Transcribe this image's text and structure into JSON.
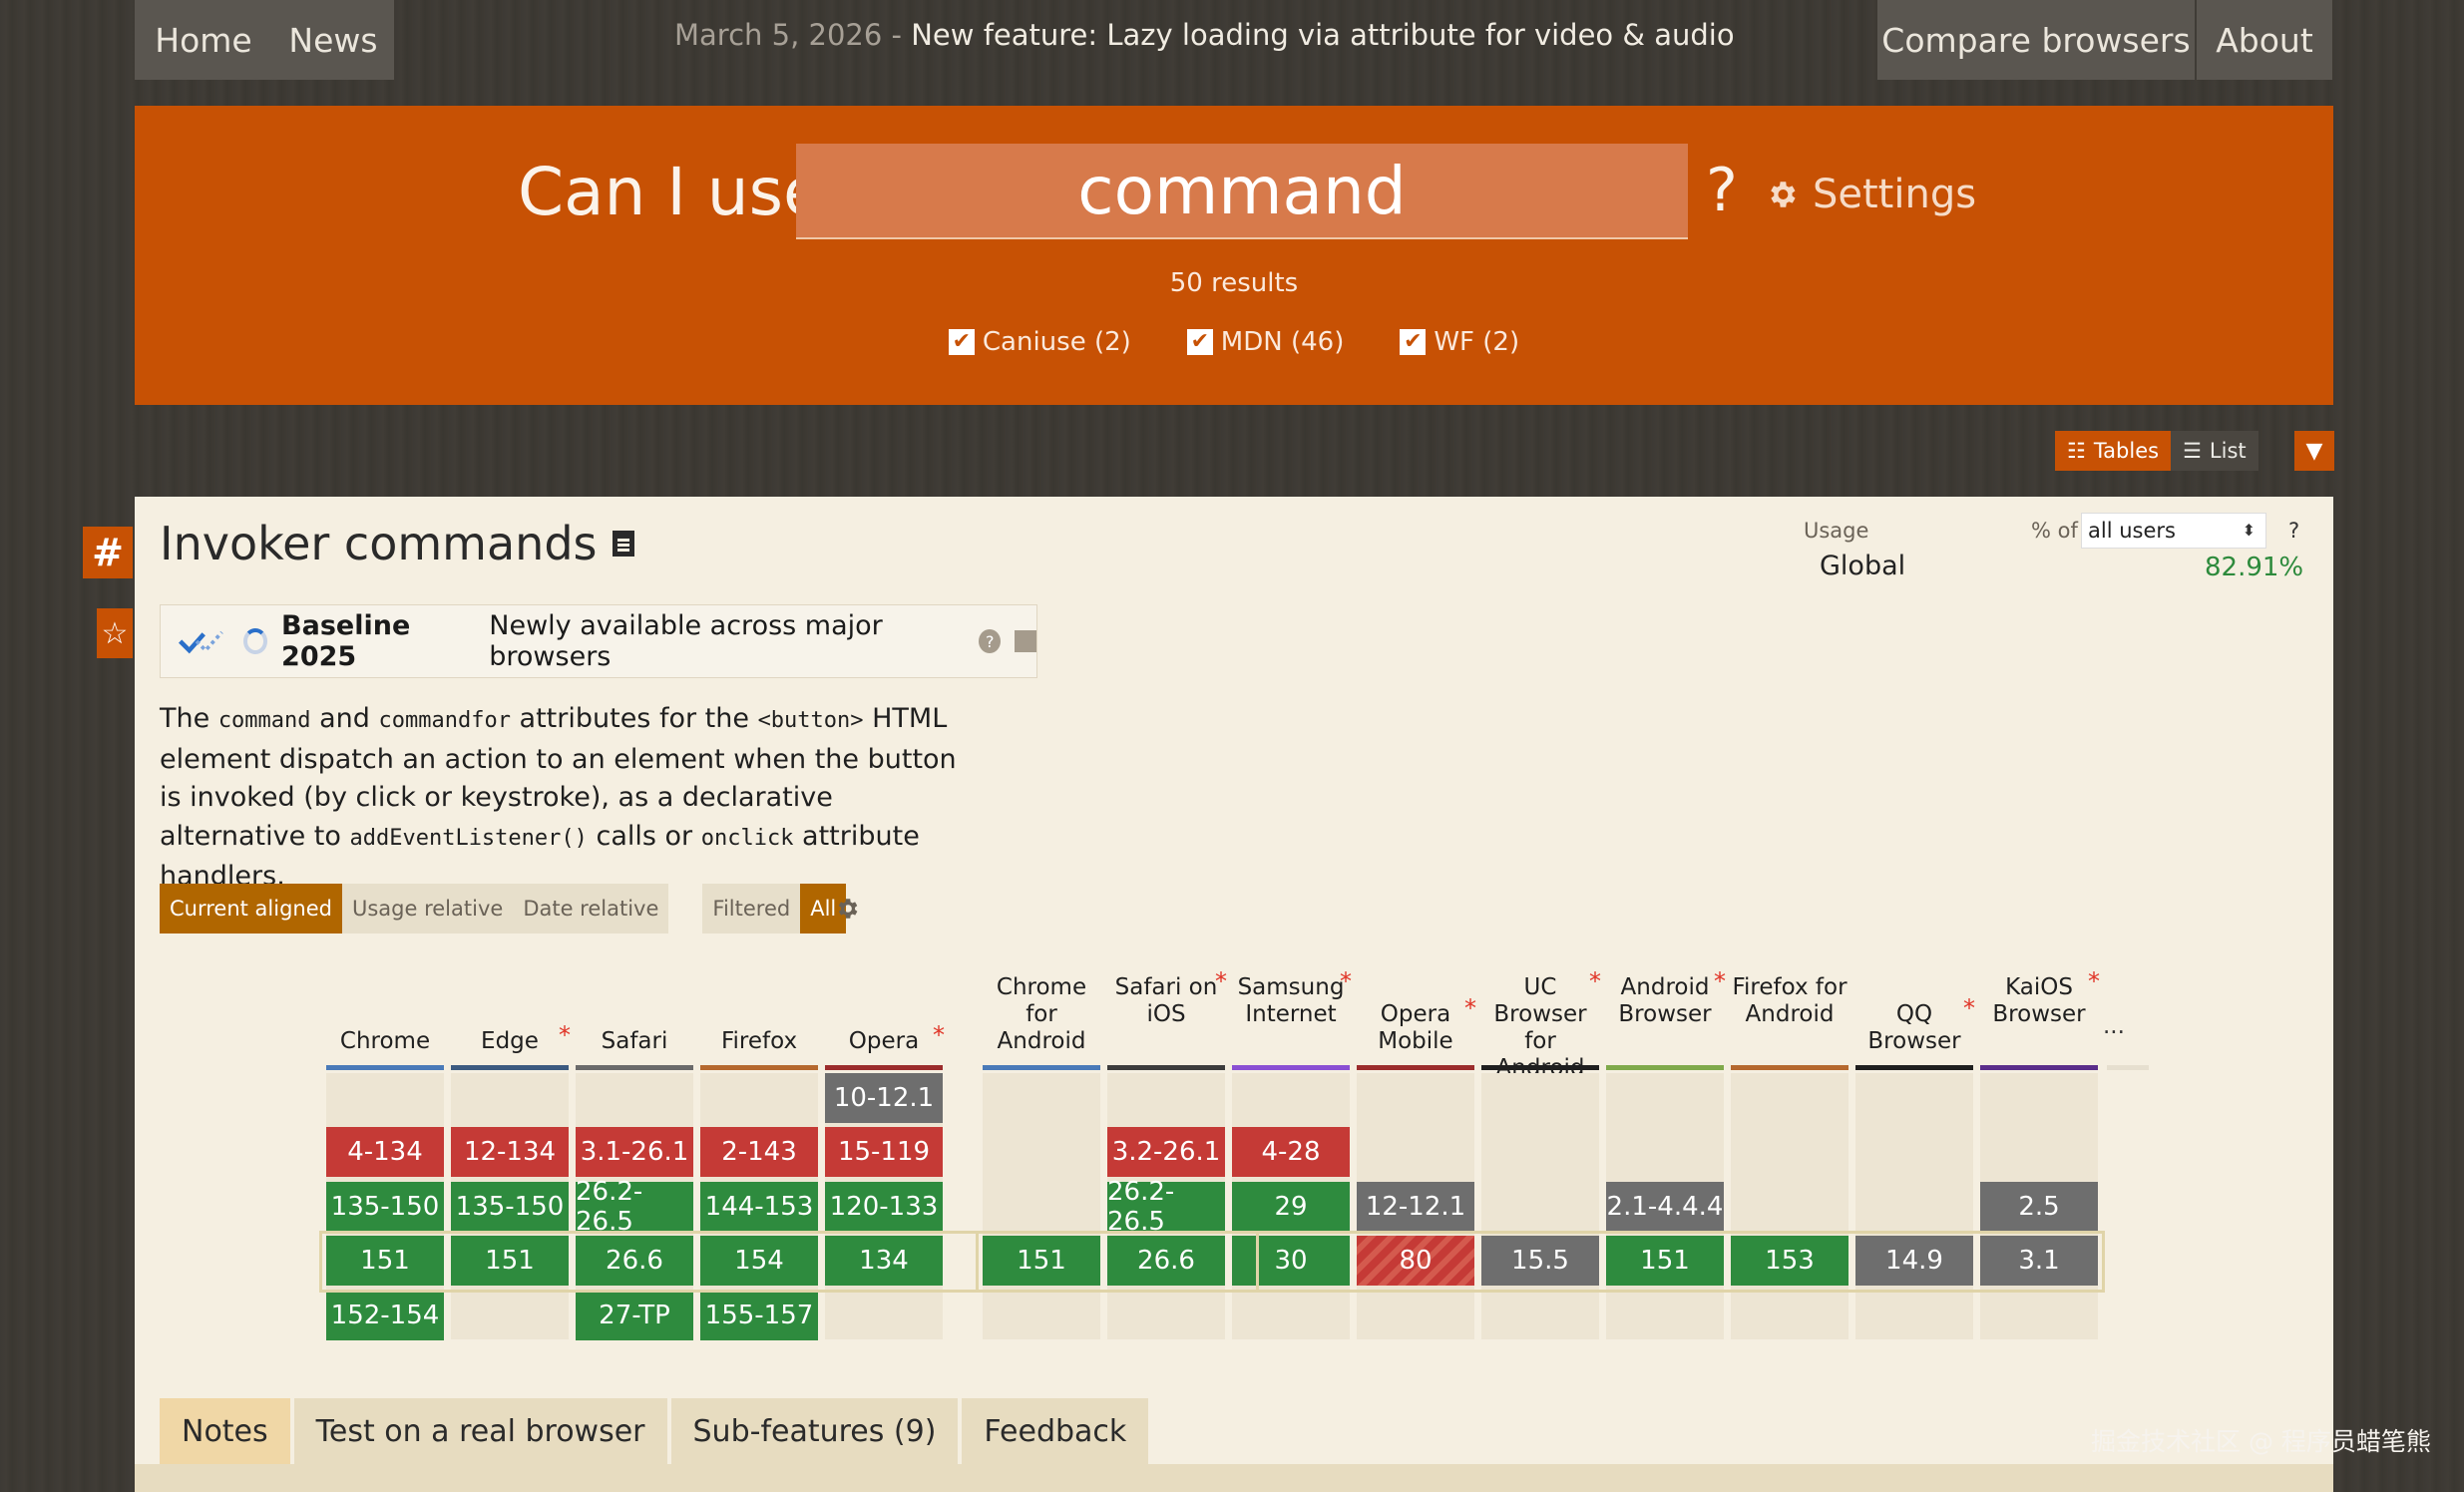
{
  "nav": {
    "home": "Home",
    "news": "News",
    "date": "March 5, 2026",
    "sep": " - ",
    "announcement": "New feature: Lazy loading via attribute for video & audio",
    "compare": "Compare browsers",
    "about": "About"
  },
  "hero": {
    "label": "Can I use",
    "query": "command",
    "qmark": "?",
    "settings": "Settings",
    "results": "50 results",
    "filters": [
      {
        "label": "Caniuse (2)",
        "checked": true
      },
      {
        "label": "MDN (46)",
        "checked": true
      },
      {
        "label": "WF (2)",
        "checked": true
      }
    ]
  },
  "view": {
    "tables": "Tables",
    "list": "List"
  },
  "feature": {
    "title": "Invoker commands",
    "hash": "#",
    "star": "☆",
    "baseline_name": "Baseline 2025",
    "baseline_desc": "Newly available across major browsers",
    "desc": {
      "t1": "The ",
      "c1": "command",
      "t2": " and ",
      "c2": "commandfor",
      "t3": " attributes for the ",
      "c3": "<button>",
      "t4": " HTML element dispatch an action to an element when the button is invoked (by click or keystroke), as a declarative alternative to ",
      "c4": "addEventListener()",
      "t5": " calls or ",
      "c5": "onclick",
      "t6": " attribute handlers."
    }
  },
  "modes": {
    "current": "Current aligned",
    "usage": "Usage relative",
    "date": "Date relative",
    "filtered": "Filtered",
    "all": "All"
  },
  "usage": {
    "label": "Usage",
    "pctof": "% of",
    "select": "all users",
    "q": "?",
    "region": "Global",
    "value": "82.91%"
  },
  "browsers": [
    {
      "name": "Chrome",
      "ast": "",
      "line": "#4a7ab8",
      "cells": [
        null,
        [
          "4-134",
          "r"
        ],
        [
          "135-150",
          "g"
        ],
        [
          "151",
          "g"
        ],
        [
          "152-154",
          "g"
        ]
      ]
    },
    {
      "name": "Edge",
      "ast": "*",
      "line": "#3c5a80",
      "cells": [
        null,
        [
          "12-134",
          "r"
        ],
        [
          "135-150",
          "g"
        ],
        [
          "151",
          "g"
        ],
        null
      ]
    },
    {
      "name": "Safari",
      "ast": "",
      "line": "#6a6a6a",
      "cells": [
        null,
        [
          "3.1-26.1",
          "r"
        ],
        [
          "26.2-26.5",
          "g"
        ],
        [
          "26.6",
          "g"
        ],
        [
          "27-TP",
          "g"
        ]
      ]
    },
    {
      "name": "Firefox",
      "ast": "",
      "line": "#b5682e",
      "cells": [
        null,
        [
          "2-143",
          "r"
        ],
        [
          "144-153",
          "g"
        ],
        [
          "154",
          "g"
        ],
        [
          "155-157",
          "g"
        ]
      ]
    },
    {
      "name": "Opera",
      "ast": "*",
      "line": "#9b2c2c",
      "cells": [
        [
          "10-12.1",
          "gr"
        ],
        [
          "15-119",
          "r"
        ],
        [
          "120-133",
          "g"
        ],
        [
          "134",
          "g"
        ],
        null
      ]
    },
    {
      "name": "Chrome for Android",
      "ast": "",
      "line": "#4a7ab8",
      "cells": [
        null,
        null,
        null,
        [
          "151",
          "g"
        ],
        null
      ]
    },
    {
      "name": "Safari on iOS",
      "ast": "*",
      "line": "#3c3c3c",
      "cells": [
        null,
        [
          "3.2-26.1",
          "r"
        ],
        [
          "26.2-26.5",
          "g"
        ],
        [
          "26.6",
          "g"
        ],
        null
      ]
    },
    {
      "name": "Samsung Internet",
      "ast": "*",
      "line": "#8a4fd3",
      "cells": [
        null,
        [
          "4-28",
          "r"
        ],
        [
          "29",
          "g"
        ],
        [
          "30",
          "g"
        ],
        null
      ]
    },
    {
      "name": "Opera Mobile",
      "ast": "*",
      "line": "#9b2c2c",
      "cells": [
        null,
        null,
        [
          "12-12.1",
          "gr"
        ],
        [
          "80",
          "rs"
        ],
        null
      ]
    },
    {
      "name": "UC Browser for Android",
      "ast": "*",
      "line": "#1f1f1f",
      "cells": [
        null,
        null,
        null,
        [
          "15.5",
          "gr"
        ],
        null
      ]
    },
    {
      "name": "Android Browser",
      "ast": "*",
      "line": "#7fa94a",
      "cells": [
        null,
        null,
        [
          "2.1-4.4.4",
          "gr"
        ],
        [
          "151",
          "g"
        ],
        null
      ]
    },
    {
      "name": "Firefox for Android",
      "ast": "",
      "line": "#b5682e",
      "cells": [
        null,
        null,
        null,
        [
          "153",
          "g"
        ],
        null
      ]
    },
    {
      "name": "QQ Browser",
      "ast": "*",
      "line": "#1f1f1f",
      "cells": [
        null,
        null,
        null,
        [
          "14.9",
          "gr"
        ],
        null
      ]
    },
    {
      "name": "KaiOS Browser",
      "ast": "*",
      "line": "#5a2d8a",
      "cells": [
        null,
        null,
        [
          "2.5",
          "gr"
        ],
        [
          "3.1",
          "gr"
        ],
        null
      ]
    }
  ],
  "more": "...",
  "tabs": [
    "Notes",
    "Test on a real browser",
    "Sub-features (9)",
    "Feedback"
  ],
  "watermark": "掘金技术社区 @ 程序员蜡笔熊",
  "colors": {
    "accent": "#c75104",
    "supported": "#2e8b3e",
    "unsupported": "#c53a36",
    "unknown": "#6e6e6e"
  }
}
